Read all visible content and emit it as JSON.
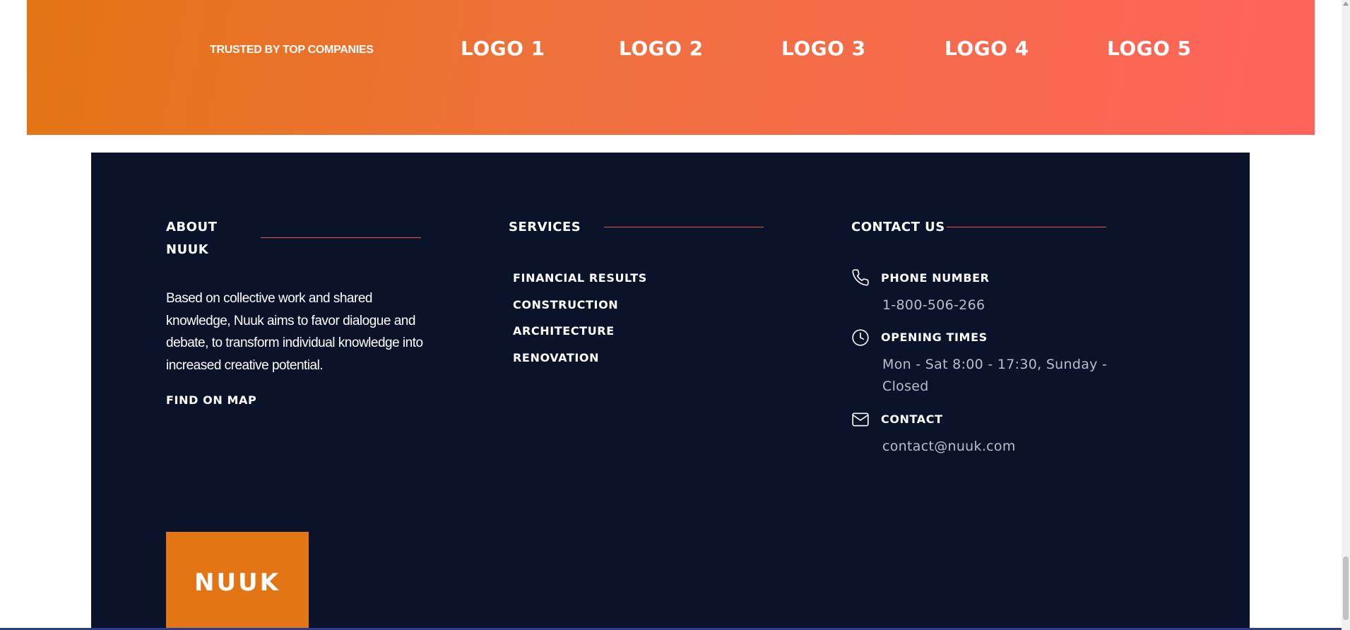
{
  "trusted": {
    "label": "TRUSTED BY TOP COMPANIES",
    "logos": [
      "LOGO 1",
      "LOGO 2",
      "LOGO 3",
      "LOGO 4",
      "LOGO 5"
    ]
  },
  "footer": {
    "about": {
      "title_line1": "ABOUT",
      "title_line2": "NUUK",
      "text": "Based on collective work and shared knowledge, Nuuk aims to favor dialogue and debate, to transform individual knowledge into increased creative potential.",
      "map_link": "FIND ON MAP"
    },
    "services": {
      "title": "SERVICES",
      "items": [
        "FINANCIAL RESULTS",
        "CONSTRUCTION",
        "ARCHITECTURE",
        "RENOVATION"
      ]
    },
    "contact": {
      "title": "CONTACT US",
      "phone_label": "PHONE NUMBER",
      "phone_value": "1-800-506-266",
      "hours_label": "OPENING TIMES",
      "hours_value": "Mon - Sat 8:00 - 17:30, Sunday - Closed",
      "email_label": "CONTACT",
      "email_value": "contact@nuuk.com",
      "icons": [
        "phone-icon",
        "clock-icon",
        "mail-icon"
      ]
    },
    "brand": "NUUK"
  },
  "colors": {
    "band_start": "#e37514",
    "band_end": "#ff645b",
    "footer_bg": "#0b132b",
    "accent_rule": "#e9574a",
    "brand_box": "#e37514"
  }
}
